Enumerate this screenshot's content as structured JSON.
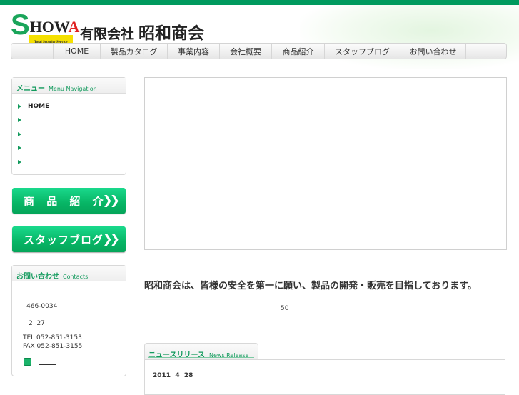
{
  "header": {
    "logo_text": "SHOWA",
    "logo_tagline": "Total Security Service",
    "company_prefix": "有限会社",
    "company_name": "昭和商会"
  },
  "nav": {
    "items": [
      "HOME",
      "製品カタログ",
      "事業内容",
      "会社概要",
      "商品紹介",
      "スタッフブログ",
      "お問い合わせ"
    ]
  },
  "menu": {
    "title_jp": "メニュー",
    "title_en": "Menu Navigation",
    "items": [
      "HOME",
      "",
      "",
      "",
      ""
    ]
  },
  "buttons": {
    "products": "商 品 紹 介",
    "blog": "スタッフブログ",
    "chevron": "❯❯"
  },
  "contacts": {
    "title_jp": "お問い合わせ",
    "title_en": "Contacts",
    "postal": "466-0034",
    "address": "2  27",
    "tel": "TEL 052-851-3153",
    "fax": "FAX 052-851-3155"
  },
  "main": {
    "tagline": "昭和商会は、皆様の安全を第一に願い、製品の開発・販売を目指しております。",
    "years": "50"
  },
  "news": {
    "title_jp": "ニュースリリース",
    "title_en": "News Release",
    "date": "2011  4  28"
  },
  "colors": {
    "brand_green": "#009a5e",
    "button_green": "#07b565"
  }
}
